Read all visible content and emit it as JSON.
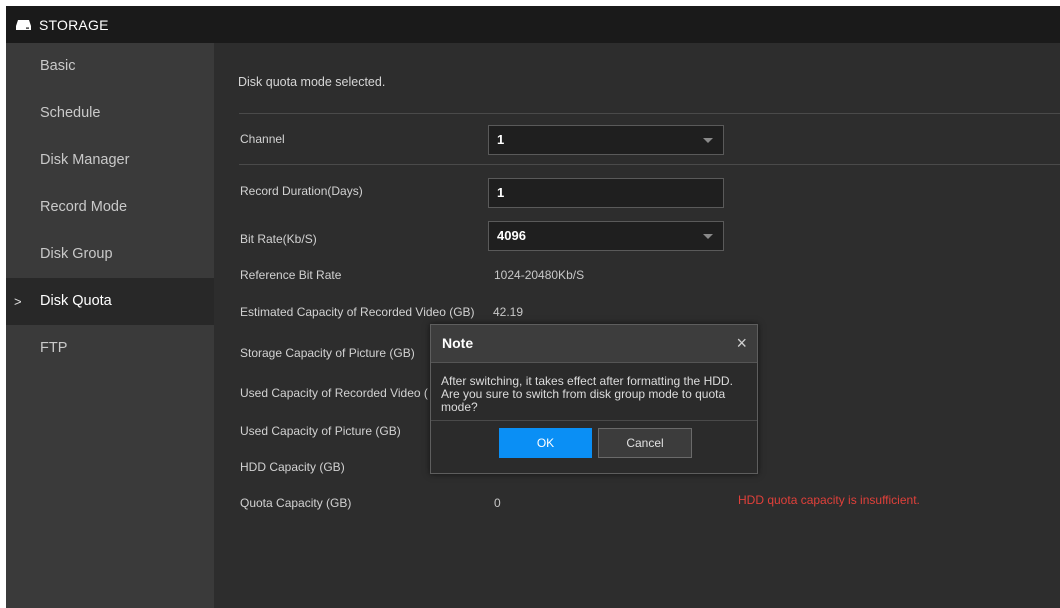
{
  "titlebar": {
    "title": "STORAGE",
    "icon": "hdd-icon"
  },
  "sidebar": {
    "items": [
      {
        "label": "Basic",
        "active": false
      },
      {
        "label": "Schedule",
        "active": false
      },
      {
        "label": "Disk Manager",
        "active": false
      },
      {
        "label": "Record Mode",
        "active": false
      },
      {
        "label": "Disk Group",
        "active": false
      },
      {
        "label": "Disk Quota",
        "active": true,
        "marker": ">"
      },
      {
        "label": "FTP",
        "active": false
      }
    ]
  },
  "main": {
    "hint": "Disk quota mode selected.",
    "channel": {
      "label": "Channel",
      "value": "1"
    },
    "record_duration": {
      "label": "Record Duration(Days)",
      "value": "1"
    },
    "bit_rate": {
      "label": "Bit Rate(Kb/S)",
      "value": "4096"
    },
    "reference_bit_rate": {
      "label": "Reference Bit Rate",
      "value": "1024-20480Kb/S"
    },
    "est_capacity": {
      "label": "Estimated Capacity of Recorded Video (GB)",
      "value": "42.19"
    },
    "storage_picture": {
      "label": "Storage Capacity of Picture (GB)"
    },
    "used_video": {
      "label": "Used Capacity of Recorded Video ("
    },
    "used_picture": {
      "label": "Used Capacity of Picture (GB)"
    },
    "hdd_capacity": {
      "label": "HDD Capacity (GB)"
    },
    "quota_capacity": {
      "label": "Quota Capacity (GB)",
      "value": "0"
    },
    "warning": "HDD quota capacity is insufficient.",
    "warning_color": "#e0403a"
  },
  "dialog": {
    "title": "Note",
    "close": "×",
    "message": "After switching, it takes effect after formatting the HDD. Are you sure to switch from disk group mode to quota mode?",
    "ok_label": "OK",
    "cancel_label": "Cancel",
    "ok_color": "#0a8ff5"
  }
}
